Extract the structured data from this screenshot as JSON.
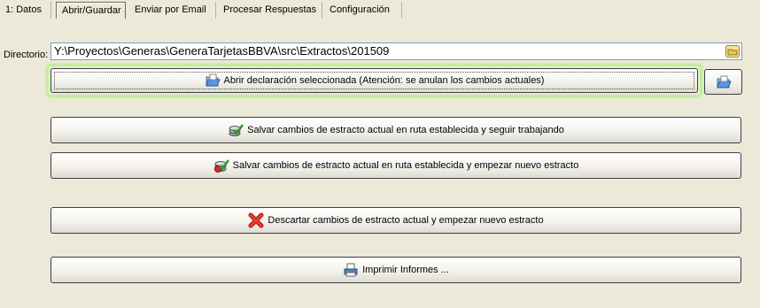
{
  "tabs": [
    {
      "label": "1: Datos",
      "active": false
    },
    {
      "label": "Abrir/Guardar",
      "active": true
    },
    {
      "label": "Enviar por Email",
      "active": false
    },
    {
      "label": "Procesar Respuestas",
      "active": false
    },
    {
      "label": "Configuración",
      "active": false
    }
  ],
  "directory": {
    "label": "Directorio:",
    "value": "Y:\\Proyectos\\Generas\\GeneraTarjetasBBVA\\src\\Extractos\\201509"
  },
  "buttons": {
    "open_label": "Abrir declaración seleccionada (Atención: se anulan los cambios actuales)",
    "save_continue_label": "Salvar cambios de estracto actual en ruta establecida y seguir trabajando",
    "save_new_label": "Salvar cambios de estracto actual en ruta establecida y empezar nuevo estracto",
    "discard_label": "Descartar cambios de estracto actual y empezar nuevo estracto",
    "print_label": "Imprimir Informes ..."
  },
  "icons": {
    "open": "open-folder-icon",
    "open_small": "open-folder-icon",
    "save_continue": "database-save-icon",
    "save_new": "database-save-new-icon",
    "discard": "red-x-icon",
    "print": "printer-icon",
    "browse": "folder-icon"
  },
  "colors": {
    "background": "#ece9d8",
    "focus_glow": "#b6f58a",
    "button_border": "#3c3f48"
  }
}
